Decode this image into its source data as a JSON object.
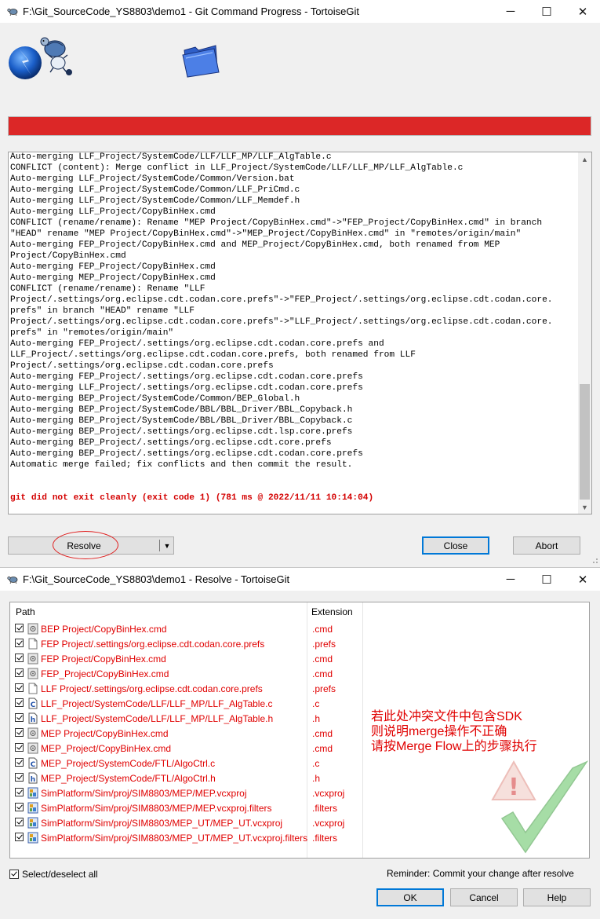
{
  "progress_window": {
    "title": "F:\\Git_SourceCode_YS8803\\demo1 - Git Command Progress - TortoiseGit",
    "progress_percent": 100,
    "progress_color": "#dc2727",
    "log_lines": [
      "Auto-merging LLF_Project/SystemCode/LLF/LLF_MP/LLF_AlgTable.c",
      "CONFLICT (content): Merge conflict in LLF_Project/SystemCode/LLF/LLF_MP/LLF_AlgTable.c",
      "Auto-merging LLF_Project/SystemCode/Common/Version.bat",
      "Auto-merging LLF_Project/SystemCode/Common/LLF_PriCmd.c",
      "Auto-merging LLF_Project/SystemCode/Common/LLF_Memdef.h",
      "Auto-merging LLF_Project/CopyBinHex.cmd",
      "CONFLICT (rename/rename): Rename \"MEP Project/CopyBinHex.cmd\"->\"FEP_Project/CopyBinHex.cmd\" in branch",
      "\"HEAD\" rename \"MEP Project/CopyBinHex.cmd\"->\"MEP_Project/CopyBinHex.cmd\" in \"remotes/origin/main\"",
      "Auto-merging FEP_Project/CopyBinHex.cmd and MEP_Project/CopyBinHex.cmd, both renamed from MEP",
      "Project/CopyBinHex.cmd",
      "Auto-merging FEP_Project/CopyBinHex.cmd",
      "Auto-merging MEP_Project/CopyBinHex.cmd",
      "CONFLICT (rename/rename): Rename \"LLF",
      "Project/.settings/org.eclipse.cdt.codan.core.prefs\"->\"FEP_Project/.settings/org.eclipse.cdt.codan.core.",
      "prefs\" in branch \"HEAD\" rename \"LLF",
      "Project/.settings/org.eclipse.cdt.codan.core.prefs\"->\"LLF_Project/.settings/org.eclipse.cdt.codan.core.",
      "prefs\" in \"remotes/origin/main\"",
      "Auto-merging FEP_Project/.settings/org.eclipse.cdt.codan.core.prefs and",
      "LLF_Project/.settings/org.eclipse.cdt.codan.core.prefs, both renamed from LLF",
      "Project/.settings/org.eclipse.cdt.codan.core.prefs",
      "Auto-merging FEP_Project/.settings/org.eclipse.cdt.codan.core.prefs",
      "Auto-merging LLF_Project/.settings/org.eclipse.cdt.codan.core.prefs",
      "Auto-merging BEP_Project/SystemCode/Common/BEP_Global.h",
      "Auto-merging BEP_Project/SystemCode/BBL/BBL_Driver/BBL_Copyback.h",
      "Auto-merging BEP_Project/SystemCode/BBL/BBL_Driver/BBL_Copyback.c",
      "Auto-merging BEP_Project/.settings/org.eclipse.cdt.lsp.core.prefs",
      "Auto-merging BEP_Project/.settings/org.eclipse.cdt.core.prefs",
      "Auto-merging BEP_Project/.settings/org.eclipse.cdt.codan.core.prefs",
      "Automatic merge failed; fix conflicts and then commit the result.",
      "",
      "",
      "git did not exit cleanly (exit code 1) (781 ms @ 2022/11/11 10:14:04)"
    ],
    "error_line_index": 31,
    "error_color": "#d40000",
    "buttons": {
      "resolve": "Resolve",
      "close": "Close",
      "abort": "Abort"
    }
  },
  "resolve_window": {
    "title": "F:\\Git_SourceCode_YS8803\\demo1 - Resolve - TortoiseGit",
    "columns": {
      "path": "Path",
      "extension": "Extension"
    },
    "files": [
      {
        "path": "BEP Project/CopyBinHex.cmd",
        "ext": ".cmd",
        "icon": "script-file-icon"
      },
      {
        "path": "FEP Project/.settings/org.eclipse.cdt.codan.core.prefs",
        "ext": ".prefs",
        "icon": "blank-file-icon"
      },
      {
        "path": "FEP Project/CopyBinHex.cmd",
        "ext": ".cmd",
        "icon": "script-file-icon"
      },
      {
        "path": "FEP_Project/CopyBinHex.cmd",
        "ext": ".cmd",
        "icon": "script-file-icon"
      },
      {
        "path": "LLF Project/.settings/org.eclipse.cdt.codan.core.prefs",
        "ext": ".prefs",
        "icon": "blank-file-icon"
      },
      {
        "path": "LLF_Project/SystemCode/LLF/LLF_MP/LLF_AlgTable.c",
        "ext": ".c",
        "icon": "c-file-icon"
      },
      {
        "path": "LLF_Project/SystemCode/LLF/LLF_MP/LLF_AlgTable.h",
        "ext": ".h",
        "icon": "h-file-icon"
      },
      {
        "path": "MEP Project/CopyBinHex.cmd",
        "ext": ".cmd",
        "icon": "script-file-icon"
      },
      {
        "path": "MEP_Project/CopyBinHex.cmd",
        "ext": ".cmd",
        "icon": "script-file-icon"
      },
      {
        "path": "MEP_Project/SystemCode/FTL/AlgoCtrl.c",
        "ext": ".c",
        "icon": "c-file-icon"
      },
      {
        "path": "MEP_Project/SystemCode/FTL/AlgoCtrl.h",
        "ext": ".h",
        "icon": "h-file-icon"
      },
      {
        "path": "SimPlatform/Sim/proj/SIM8803/MEP/MEP.vcxproj",
        "ext": ".vcxproj",
        "icon": "vcxproj-file-icon"
      },
      {
        "path": "SimPlatform/Sim/proj/SIM8803/MEP/MEP.vcxproj.filters",
        "ext": ".filters",
        "icon": "vcxproj-file-icon"
      },
      {
        "path": "SimPlatform/Sim/proj/SIM8803/MEP_UT/MEP_UT.vcxproj",
        "ext": ".vcxproj",
        "icon": "vcxproj-file-icon"
      },
      {
        "path": "SimPlatform/Sim/proj/SIM8803/MEP_UT/MEP_UT.vcxproj.filters",
        "ext": ".filters",
        "icon": "vcxproj-file-icon"
      }
    ],
    "file_color": "#e00000",
    "annotation": "若此处冲突文件中包含SDK\n则说明merge操作不正确\n请按Merge Flow上的步骤执行",
    "select_all": "Select/deselect all",
    "reminder": "Reminder: Commit your change after resolve",
    "buttons": {
      "ok": "OK",
      "cancel": "Cancel",
      "help": "Help"
    }
  },
  "window_controls": {
    "minimize": "─",
    "maximize": "☐",
    "close": "✕"
  }
}
